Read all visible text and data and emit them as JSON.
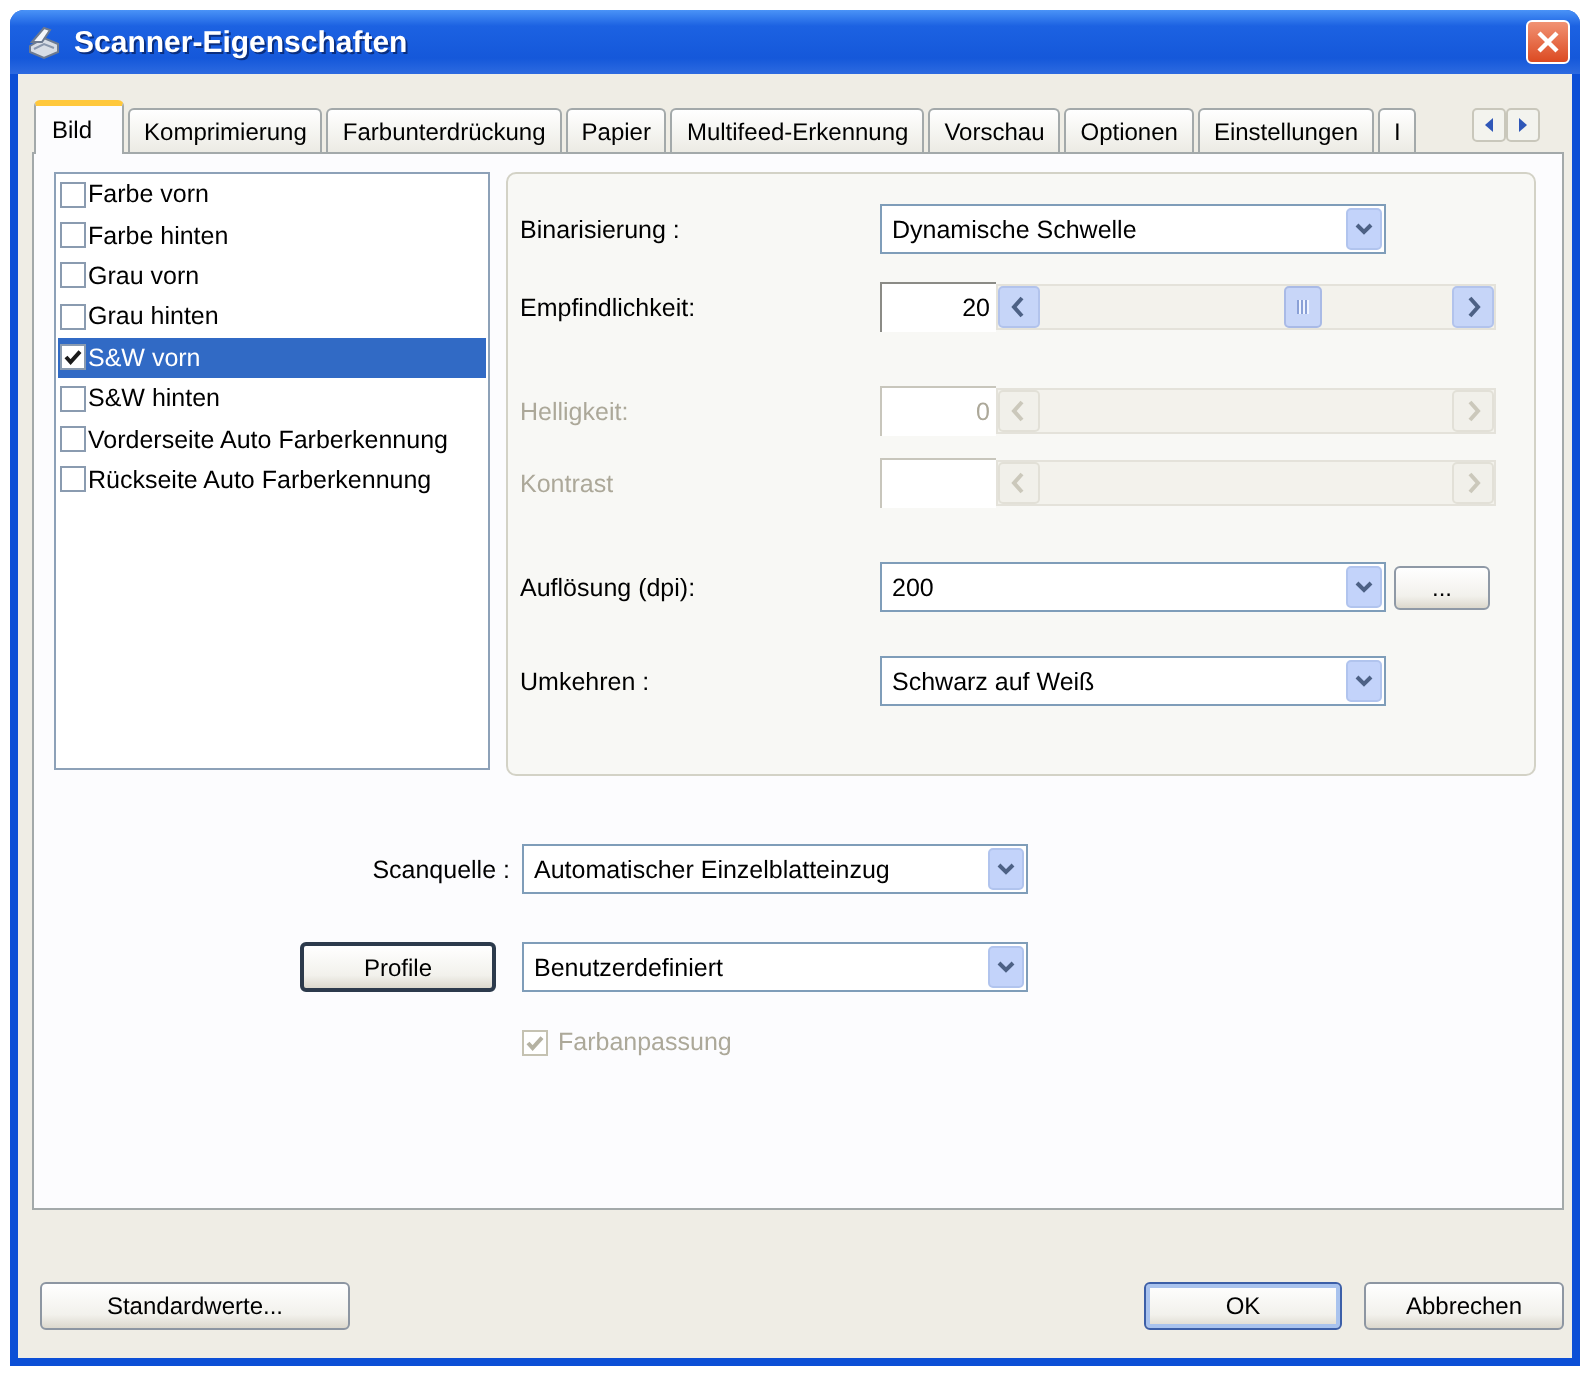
{
  "window": {
    "title": "Scanner-Eigenschaften"
  },
  "tabs": [
    {
      "label": "Bild",
      "selected": true
    },
    {
      "label": "Komprimierung",
      "selected": false
    },
    {
      "label": "Farbunterdrückung",
      "selected": false
    },
    {
      "label": "Papier",
      "selected": false
    },
    {
      "label": "Multifeed-Erkennung",
      "selected": false
    },
    {
      "label": "Vorschau",
      "selected": false
    },
    {
      "label": "Optionen",
      "selected": false
    },
    {
      "label": "Einstellungen",
      "selected": false
    },
    {
      "label": "I",
      "selected": false
    }
  ],
  "image_types": [
    {
      "label": "Farbe vorn",
      "checked": false,
      "selected": false
    },
    {
      "label": "Farbe hinten",
      "checked": false,
      "selected": false
    },
    {
      "label": "Grau vorn",
      "checked": false,
      "selected": false
    },
    {
      "label": "Grau hinten",
      "checked": false,
      "selected": false
    },
    {
      "label": "S&W vorn",
      "checked": true,
      "selected": true
    },
    {
      "label": "S&W hinten",
      "checked": false,
      "selected": false
    },
    {
      "label": "Vorderseite Auto Farberkennung",
      "checked": false,
      "selected": false
    },
    {
      "label": "Rückseite Auto Farberkennung",
      "checked": false,
      "selected": false
    }
  ],
  "settings": [
    {
      "kind": "dropdown",
      "label": "Binarisierung :",
      "value": "Dynamische Schwelle"
    },
    {
      "kind": "slider",
      "label": "Empfindlichkeit:",
      "value": "20",
      "level": 0.65,
      "disabled": false
    },
    {
      "kind": "slider",
      "label": "Helligkeit:",
      "value": "0",
      "disabled": true
    },
    {
      "kind": "slider",
      "label": "Kontrast",
      "disabled": true
    },
    {
      "kind": "dropdown",
      "label": "Auflösung (dpi):",
      "value": "200",
      "button": "..."
    },
    {
      "kind": "dropdown",
      "label": "Umkehren :",
      "value": "Schwarz auf Weiß"
    }
  ],
  "scan_source": {
    "label": "Scanquelle :",
    "value": "Automatischer Einzelblatteinzug"
  },
  "profile": {
    "button": "Profile",
    "value": "Benutzerdefiniert"
  },
  "color_matching": {
    "label": "Farbanpassung",
    "checked": true,
    "disabled": true
  },
  "footer": {
    "left_buttons": [
      {
        "label": "Standardwerte...",
        "default": false
      }
    ],
    "right_buttons": [
      {
        "label": "OK",
        "default": true
      },
      {
        "label": "Abbrechen",
        "default": false
      }
    ]
  }
}
